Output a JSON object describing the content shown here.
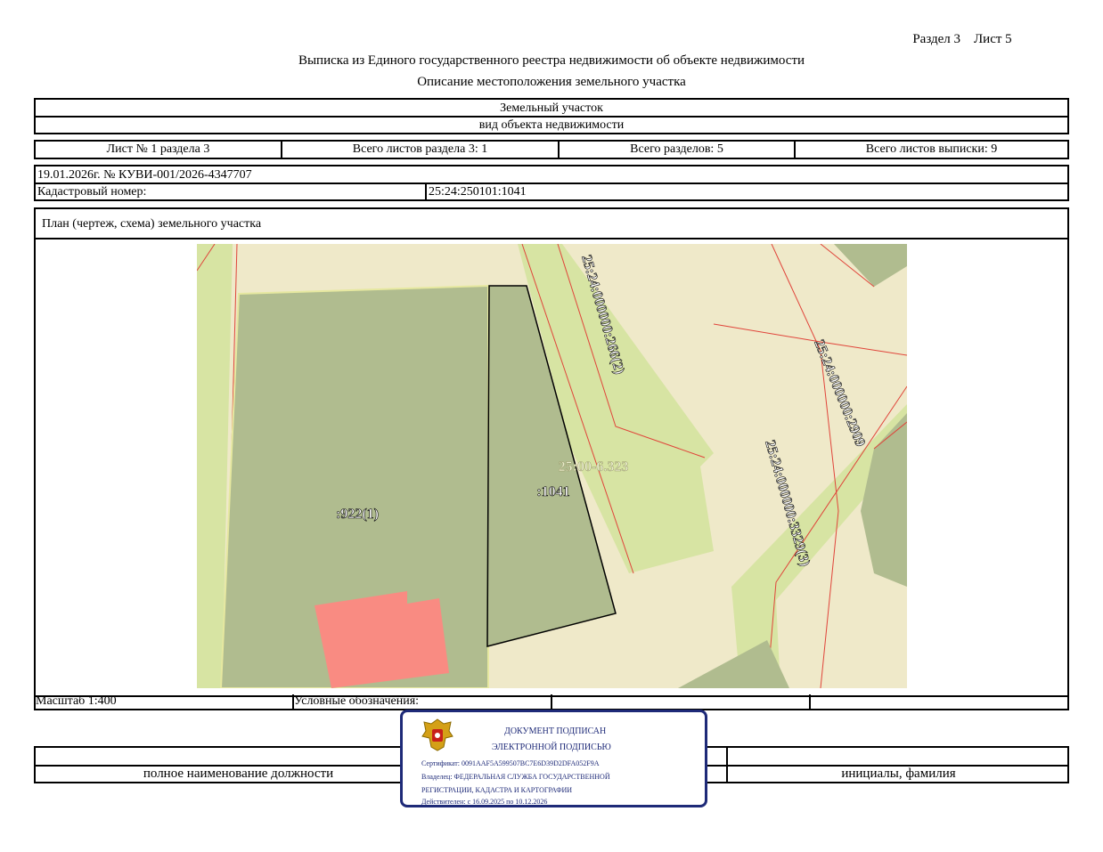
{
  "header": {
    "section_sheet": "Раздел 3    Лист 5",
    "title": "Выписка из Единого государственного реестра недвижимости об объекте недвижимости",
    "subtitle": "Описание местоположения земельного участка"
  },
  "object": {
    "type": "Земельный участок",
    "type_caption": "вид объекта недвижимости"
  },
  "sheet_row": {
    "sheet": "Лист № 1 раздела 3",
    "total_section_sheets": "Всего листов раздела 3: 1",
    "total_sections": "Всего разделов: 5",
    "total_extract_sheets": "Всего листов выписки: 9"
  },
  "doc": {
    "date_number": "19.01.2026г. № КУВИ-001/2026-4347707",
    "cadastral_label": "Кадастровый номер:",
    "cadastral_value": "25:24:250101:1041"
  },
  "plan": {
    "title": "План (чертеж, схема) земельного участка",
    "labels": {
      "parcel_922": ":922(1)",
      "parcel_1041": ":1041",
      "zone": "25:00-6.323",
      "road_266": "25:24:000000:266(2)",
      "road_2909": "25:24:000000:2909",
      "road_3329": "25:24:000000:3329(3)"
    }
  },
  "footer": {
    "scale": "Масштаб 1:400",
    "legend": "Условные обозначения:",
    "position_caption": "полное наименование должности",
    "name_caption": "инициалы, фамилия"
  },
  "stamp": {
    "line1": "ДОКУМЕНТ ПОДПИСАН",
    "line2": "ЭЛЕКТРОННОЙ ПОДПИСЬЮ",
    "certificate": "Сертификат: 0091AAF5A599507BC7E6D39D2DFA052F9A",
    "owner1": "Владелец: ФЕДЕРАЛЬНАЯ СЛУЖБА ГОСУДАРСТВЕННОЙ",
    "owner2": "РЕГИСТРАЦИИ, КАДАСТРА И КАРТОГРАФИИ",
    "valid": "Действителен: с 16.09.2025 по 10.12.2026",
    "emblem_icon": "russian-coat-of-arms"
  },
  "colors": {
    "parcel_fill": "#b0bc8f",
    "background_fill": "#efe9c9",
    "light_green": "#d7e4a3",
    "building": "#f98b82",
    "stamp_blue": "#1e2a78",
    "boundary_red": "#e0443a"
  }
}
